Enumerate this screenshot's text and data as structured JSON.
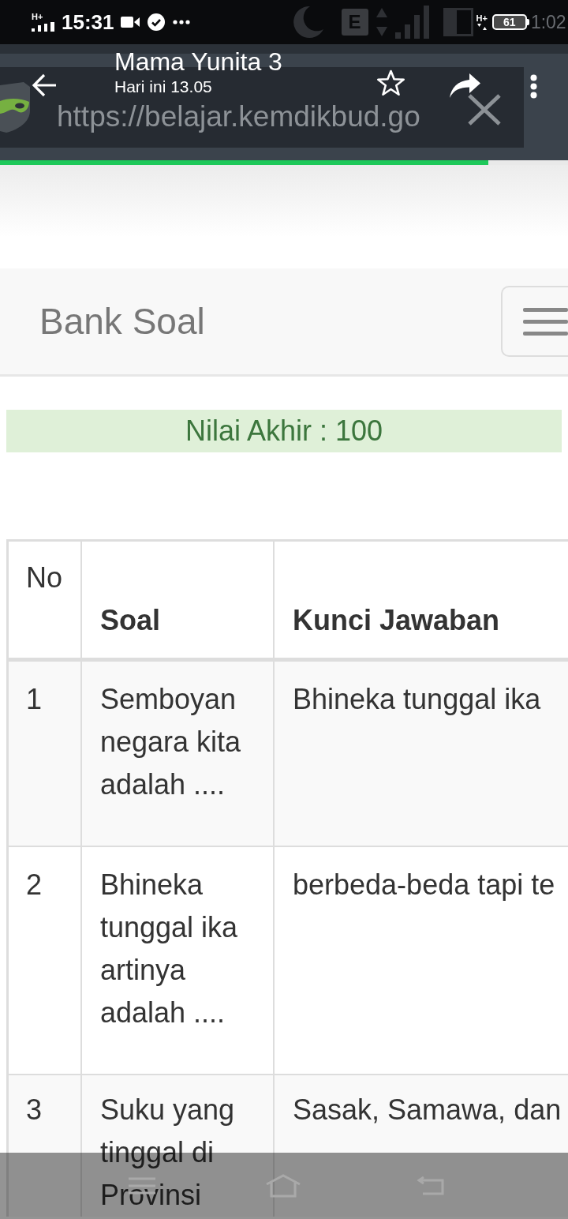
{
  "status_bar": {
    "left_network": "H+",
    "time": "15:31",
    "background_network": "E",
    "right_network": "H+",
    "battery": "61",
    "background_time": "1:02"
  },
  "browser": {
    "url": "https://belajar.kemdikbud.go",
    "progress": {
      "level": 0.86
    }
  },
  "viewer_header": {
    "title": "Mama Yunita 3",
    "subtitle": "Hari ini 13.05"
  },
  "navbar": {
    "brand": "Bank Soal"
  },
  "result_alert": {
    "text": "Nilai Akhir : 100"
  },
  "table": {
    "columns": [
      "No",
      "Soal",
      "Kunci Jawaban"
    ],
    "rows": [
      {
        "no": "1",
        "soal": "Semboyan negara kita adalah ....",
        "kunci_jawaban": "Bhineka tunggal ika"
      },
      {
        "no": "2",
        "soal": "Bhineka tunggal ika artinya adalah ....",
        "kunci_jawaban": "berbeda-beda tapi te"
      },
      {
        "no": "3",
        "soal": "Suku yang tinggal di Provinsi",
        "kunci_jawaban": "Sasak, Samawa, dan"
      }
    ]
  }
}
